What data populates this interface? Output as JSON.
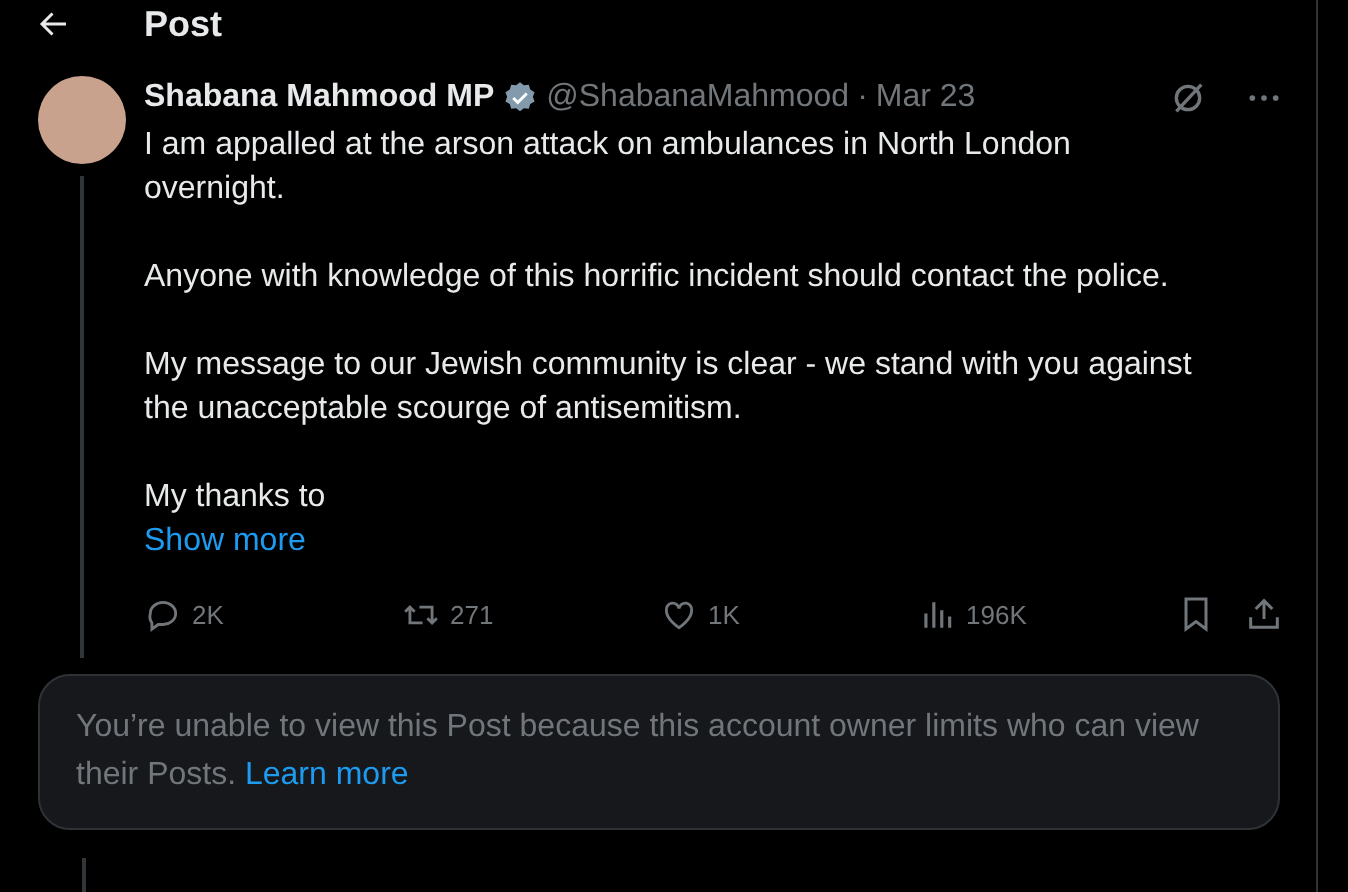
{
  "header": {
    "title": "Post"
  },
  "post": {
    "author": "Shabana Mahmood MP",
    "verified": true,
    "handle": "@ShabanaMahmood",
    "separator": "·",
    "date": "Mar 23",
    "paragraphs": [
      "I am appalled at the arson attack on ambulances in North London overnight.",
      "Anyone with knowledge of this horrific incident should contact the police.",
      "My message to our Jewish community is clear - we stand with you against the unacceptable scourge of antisemitism.",
      "My thanks to"
    ],
    "show_more": "Show more",
    "actions": [
      {
        "kind": "reply",
        "count": "2K"
      },
      {
        "kind": "repost",
        "count": "271"
      },
      {
        "kind": "like",
        "count": "1K"
      },
      {
        "kind": "views",
        "count": "196K"
      }
    ]
  },
  "notice": {
    "text": "You’re unable to view this Post because this account owner limits who can view their Posts.",
    "link": "Learn more"
  }
}
